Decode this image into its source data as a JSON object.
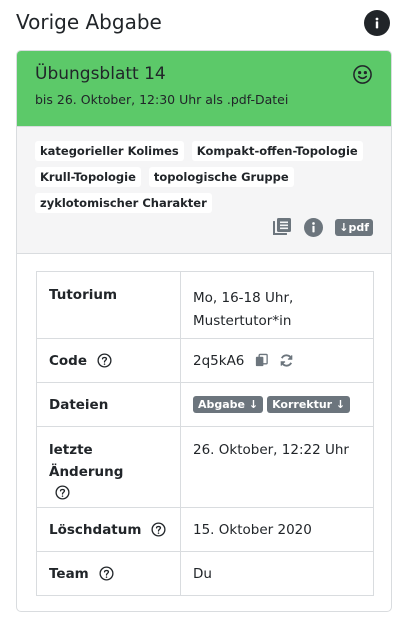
{
  "page": {
    "title": "Vorige Abgabe"
  },
  "card": {
    "title": "Übungsblatt 14",
    "subtitle": "bis 26. Oktober, 12:30 Uhr als .pdf-Datei",
    "tags": [
      "kategorieller Kolimes",
      "Kompakt-offen-Topologie",
      "Krull-Topologie",
      "topologische Gruppe",
      "zyklotomischer Charakter"
    ],
    "pdf_label": "↓pdf"
  },
  "details": {
    "tutorium": {
      "label": "Tutorium",
      "value_line1": "Mo, 16-18 Uhr,",
      "value_line2": "Mustertutor*in"
    },
    "code": {
      "label": "Code",
      "value": "2q5kA6"
    },
    "dateien": {
      "label": "Dateien",
      "abgabe": "Abgabe ↓",
      "korrektur": "Korrektur ↓"
    },
    "aenderung": {
      "label": "letzte Änderung",
      "value": "26. Oktober, 12:22 Uhr"
    },
    "loeschdatum": {
      "label": "Löschdatum",
      "value": "15. Oktober 2020"
    },
    "team": {
      "label": "Team",
      "value": "Du"
    }
  },
  "colors": {
    "header_green": "#5cc969",
    "badge_gray": "#6c757d",
    "tag_area": "#f5f5f6"
  },
  "icons": [
    "info-icon",
    "smiley-icon",
    "list-icon",
    "info-circle-icon",
    "copy-icon",
    "refresh-icon",
    "question-circle-icon"
  ]
}
